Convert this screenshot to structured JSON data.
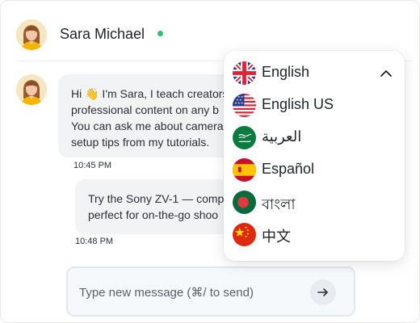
{
  "header": {
    "name": "Sara Michael",
    "status": "online"
  },
  "messages": [
    {
      "sender": "bot",
      "text": "Hi 👋 I'm Sara, I teach creators\nprofessional content on any b\nYou can ask me about camera\nsetup tips from my tutorials.",
      "time": "10:45 PM"
    },
    {
      "sender": "user",
      "text": "Try the Sony ZV-1 — comp\nperfect for on-the-go shoo",
      "time": "10:48 PM"
    }
  ],
  "composer": {
    "placeholder": "Type new message (⌘/ to send)",
    "send_icon": "arrow-right-icon"
  },
  "language_menu": {
    "expanded": true,
    "selected": "English",
    "items": [
      {
        "label": "English",
        "flag": "uk-flag-icon"
      },
      {
        "label": "English US",
        "flag": "us-flag-icon"
      },
      {
        "label": "العربية",
        "flag": "saudi-flag-icon"
      },
      {
        "label": "Español",
        "flag": "spain-flag-icon"
      },
      {
        "label": "বাংলা",
        "flag": "bangladesh-flag-icon"
      },
      {
        "label": "中文",
        "flag": "china-flag-icon"
      }
    ]
  },
  "colors": {
    "online": "#2fbf71",
    "bubble": "#f2f3f5",
    "composer_bg": "#f6f9fc"
  }
}
